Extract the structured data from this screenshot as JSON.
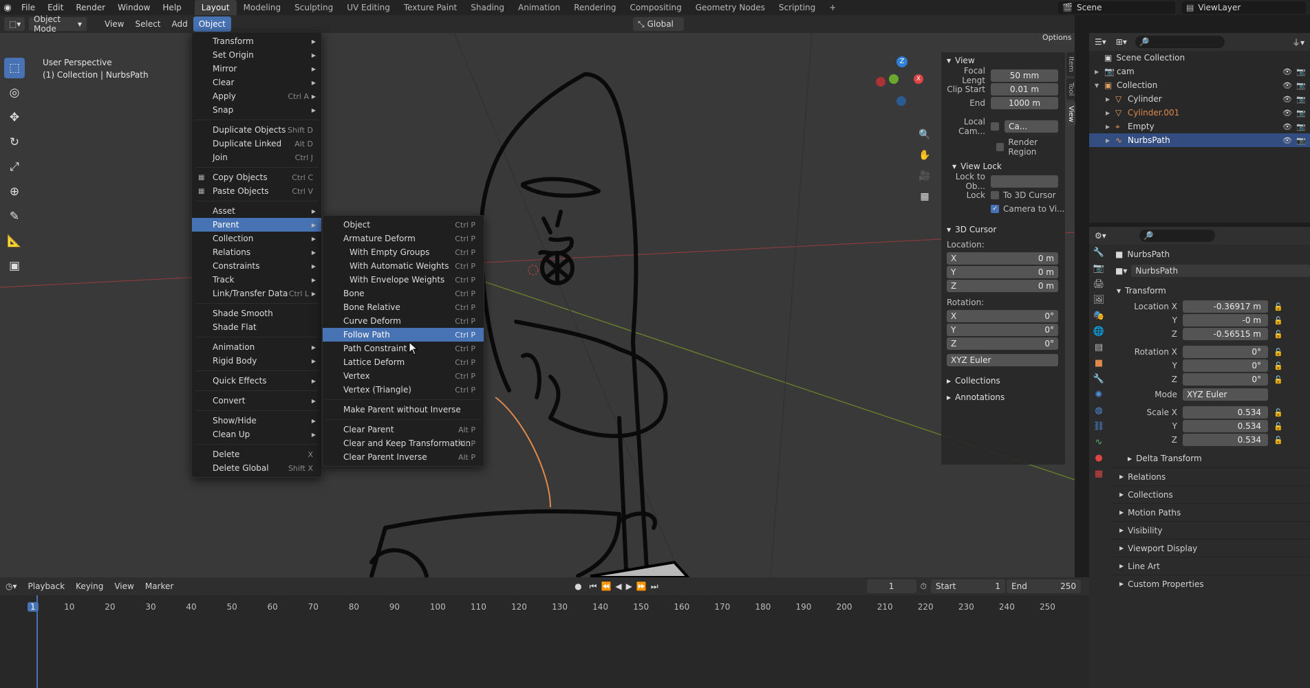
{
  "topmenu": [
    "File",
    "Edit",
    "Render",
    "Window",
    "Help"
  ],
  "workspaces": [
    "Layout",
    "Modeling",
    "Sculpting",
    "UV Editing",
    "Texture Paint",
    "Shading",
    "Animation",
    "Rendering",
    "Compositing",
    "Geometry Nodes",
    "Scripting"
  ],
  "workspace_add": "+",
  "scene_name": "Scene",
  "viewlayer_name": "ViewLayer",
  "header": {
    "mode": "Object Mode",
    "menus": [
      "View",
      "Select",
      "Add",
      "Object"
    ],
    "transform_orientation": "Global",
    "options": "Options"
  },
  "viewport": {
    "perspective": "User Perspective",
    "collection_info": "(1) Collection | NurbsPath"
  },
  "object_menu": [
    {
      "label": "Transform",
      "sc": "",
      "sub": true
    },
    {
      "label": "Set Origin",
      "sc": "",
      "sub": true
    },
    {
      "label": "Mirror",
      "sc": "",
      "sub": true
    },
    {
      "label": "Clear",
      "sc": "",
      "sub": true
    },
    {
      "label": "Apply",
      "sc": "Ctrl A",
      "sub": true
    },
    {
      "label": "Snap",
      "sc": "",
      "sub": true
    },
    {
      "sep": true
    },
    {
      "label": "Duplicate Objects",
      "sc": "Shift D"
    },
    {
      "label": "Duplicate Linked",
      "sc": "Alt D"
    },
    {
      "label": "Join",
      "sc": "Ctrl J"
    },
    {
      "sep": true
    },
    {
      "label": "Copy Objects",
      "sc": "Ctrl C",
      "icon": true
    },
    {
      "label": "Paste Objects",
      "sc": "Ctrl V",
      "icon": true
    },
    {
      "sep": true
    },
    {
      "label": "Asset",
      "sc": "",
      "sub": true
    },
    {
      "label": "Parent",
      "sc": "",
      "sub": true,
      "hl": true
    },
    {
      "label": "Collection",
      "sc": "",
      "sub": true
    },
    {
      "label": "Relations",
      "sc": "",
      "sub": true
    },
    {
      "label": "Constraints",
      "sc": "",
      "sub": true
    },
    {
      "label": "Track",
      "sc": "",
      "sub": true
    },
    {
      "label": "Link/Transfer Data",
      "sc": "Ctrl L",
      "sub": true
    },
    {
      "sep": true
    },
    {
      "label": "Shade Smooth",
      "sc": ""
    },
    {
      "label": "Shade Flat",
      "sc": ""
    },
    {
      "sep": true
    },
    {
      "label": "Animation",
      "sc": "",
      "sub": true
    },
    {
      "label": "Rigid Body",
      "sc": "",
      "sub": true
    },
    {
      "sep": true
    },
    {
      "label": "Quick Effects",
      "sc": "",
      "sub": true
    },
    {
      "sep": true
    },
    {
      "label": "Convert",
      "sc": "",
      "sub": true
    },
    {
      "sep": true
    },
    {
      "label": "Show/Hide",
      "sc": "",
      "sub": true
    },
    {
      "label": "Clean Up",
      "sc": "",
      "sub": true
    },
    {
      "sep": true
    },
    {
      "label": "Delete",
      "sc": "X"
    },
    {
      "label": "Delete Global",
      "sc": "Shift X"
    }
  ],
  "parent_menu": [
    {
      "label": "Object",
      "sc": "Ctrl P"
    },
    {
      "label": "Armature Deform",
      "sc": "Ctrl P"
    },
    {
      "label": "With Empty Groups",
      "sc": "Ctrl P",
      "ind": true
    },
    {
      "label": "With Automatic Weights",
      "sc": "Ctrl P",
      "ind": true
    },
    {
      "label": "With Envelope Weights",
      "sc": "Ctrl P",
      "ind": true
    },
    {
      "label": "Bone",
      "sc": "Ctrl P"
    },
    {
      "label": "Bone Relative",
      "sc": "Ctrl P"
    },
    {
      "label": "Curve Deform",
      "sc": "Ctrl P"
    },
    {
      "label": "Follow Path",
      "sc": "Ctrl P",
      "hl": true
    },
    {
      "label": "Path Constraint",
      "sc": "Ctrl P"
    },
    {
      "label": "Lattice Deform",
      "sc": "Ctrl P"
    },
    {
      "label": "Vertex",
      "sc": "Ctrl P"
    },
    {
      "label": "Vertex (Triangle)",
      "sc": "Ctrl P"
    },
    {
      "sep": true
    },
    {
      "label": "Make Parent without Inverse",
      "sc": ""
    },
    {
      "sep": true
    },
    {
      "label": "Clear Parent",
      "sc": "Alt P"
    },
    {
      "label": "Clear and Keep Transformation",
      "sc": "Alt P"
    },
    {
      "label": "Clear Parent Inverse",
      "sc": "Alt P"
    }
  ],
  "npanel": {
    "tabs": [
      "Item",
      "Tool",
      "View"
    ],
    "view_title": "View",
    "focal_label": "Focal Lengt",
    "focal_value": "50 mm",
    "clip_start_label": "Clip Start",
    "clip_start_value": "0.01 m",
    "clip_end_label": "End",
    "clip_end_value": "1000 m",
    "local_cam_label": "Local Cam...",
    "local_cam_value": "Ca...",
    "render_region": "Render Region",
    "view_lock_title": "View Lock",
    "lock_to_obj_label": "Lock to Ob...",
    "lock_label": "Lock",
    "to_3d_cursor": "To 3D Cursor",
    "camera_to_view": "Camera to Vi...",
    "cursor_title": "3D Cursor",
    "location_label": "Location:",
    "loc": [
      {
        "axis": "X",
        "val": "0 m"
      },
      {
        "axis": "Y",
        "val": "0 m"
      },
      {
        "axis": "Z",
        "val": "0 m"
      }
    ],
    "rotation_label": "Rotation:",
    "rot": [
      {
        "axis": "X",
        "val": "0°"
      },
      {
        "axis": "Y",
        "val": "0°"
      },
      {
        "axis": "Z",
        "val": "0°"
      }
    ],
    "rot_mode": "XYZ Euler",
    "collections": "Collections",
    "annotations": "Annotations"
  },
  "outliner": {
    "scene_collection": "Scene Collection",
    "items": [
      {
        "name": "cam",
        "level": 1
      },
      {
        "name": "Collection",
        "level": 1
      },
      {
        "name": "Cylinder",
        "level": 2
      },
      {
        "name": "Cylinder.001",
        "level": 2,
        "color": "#e0894a"
      },
      {
        "name": "Empty",
        "level": 2
      },
      {
        "name": "NurbsPath",
        "level": 2,
        "sel": true
      }
    ]
  },
  "properties": {
    "object_name": "NurbsPath",
    "object_field": "NurbsPath",
    "transform_title": "Transform",
    "location": [
      {
        "label": "Location X",
        "val": "-0.36917 m"
      },
      {
        "label": "Y",
        "val": "-0 m"
      },
      {
        "label": "Z",
        "val": "-0.56515 m"
      }
    ],
    "rotation": [
      {
        "label": "Rotation X",
        "val": "0°"
      },
      {
        "label": "Y",
        "val": "0°"
      },
      {
        "label": "Z",
        "val": "0°"
      }
    ],
    "mode_label": "Mode",
    "mode_value": "XYZ Euler",
    "scale": [
      {
        "label": "Scale X",
        "val": "0.534"
      },
      {
        "label": "Y",
        "val": "0.534"
      },
      {
        "label": "Z",
        "val": "0.534"
      }
    ],
    "delta_transform": "Delta Transform",
    "sections": [
      "Relations",
      "Collections",
      "Motion Paths",
      "Visibility",
      "Viewport Display",
      "Line Art",
      "Custom Properties"
    ]
  },
  "timeline": {
    "menus": [
      "Playback",
      "Keying",
      "View",
      "Marker"
    ],
    "current_frame": "1",
    "start_label": "Start",
    "start_value": "1",
    "end_label": "End",
    "end_value": "250",
    "ticks": [
      "1",
      "10",
      "20",
      "30",
      "40",
      "50",
      "60",
      "70",
      "80",
      "90",
      "100",
      "110",
      "120",
      "130",
      "140",
      "150",
      "160",
      "170",
      "180",
      "190",
      "200",
      "210",
      "220",
      "230",
      "240",
      "250"
    ]
  },
  "colors": {
    "accent": "#4772b3",
    "selected_row": "#334d80",
    "orange": "#e0894a"
  }
}
